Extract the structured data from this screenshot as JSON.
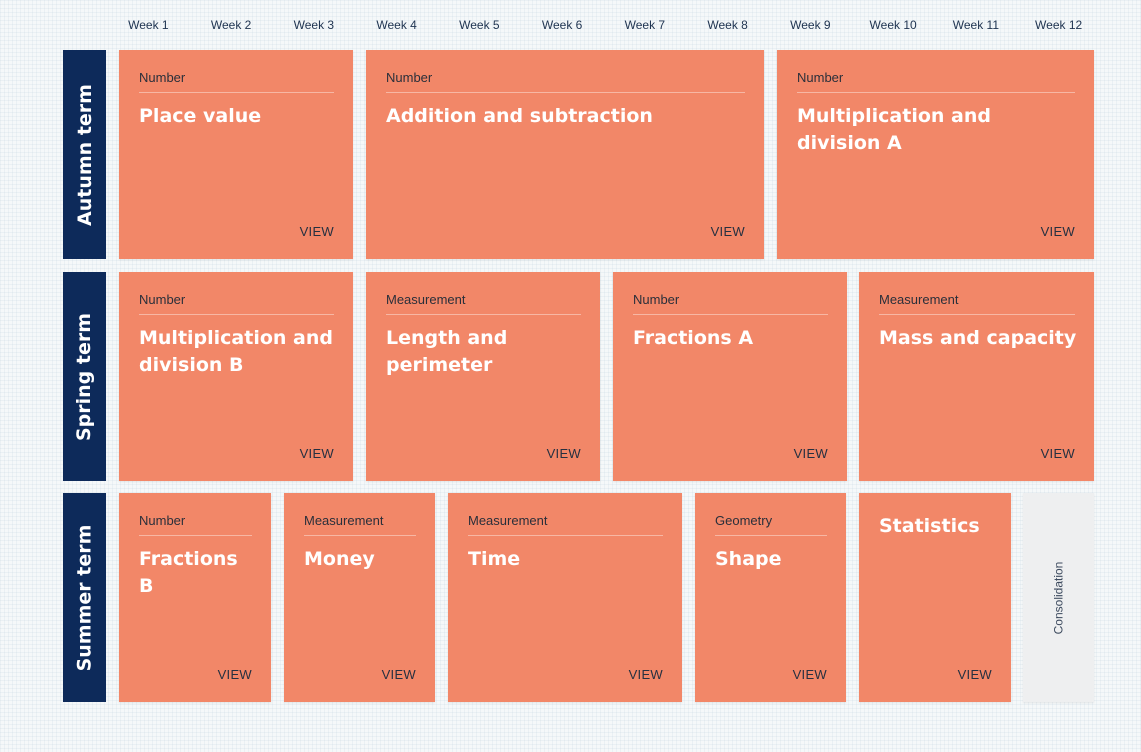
{
  "weeks": [
    "Week 1",
    "Week 2",
    "Week 3",
    "Week 4",
    "Week 5",
    "Week 6",
    "Week 7",
    "Week 8",
    "Week 9",
    "Week 10",
    "Week 11",
    "Week 12"
  ],
  "view_label": "VIEW",
  "colors": {
    "card": "#f28768",
    "term": "#0d2a5a",
    "consolidation": "#eeeff0"
  },
  "terms": [
    {
      "label": "Autumn term",
      "blocks": [
        {
          "category": "Number",
          "title": "Place value"
        },
        {
          "category": "Number",
          "title": "Addition and subtraction"
        },
        {
          "category": "Number",
          "title": "Multiplication and division A"
        }
      ]
    },
    {
      "label": "Spring term",
      "blocks": [
        {
          "category": "Number",
          "title": "Multiplication and division B"
        },
        {
          "category": "Measurement",
          "title": "Length and perimeter"
        },
        {
          "category": "Number",
          "title": "Fractions A"
        },
        {
          "category": "Measurement",
          "title": "Mass and capacity"
        }
      ]
    },
    {
      "label": "Summer term",
      "blocks": [
        {
          "category": "Number",
          "title": "Fractions B"
        },
        {
          "category": "Measurement",
          "title": "Money"
        },
        {
          "category": "Measurement",
          "title": "Time"
        },
        {
          "category": "Geometry",
          "title": "Shape"
        },
        {
          "category": "",
          "title": "Statistics"
        }
      ],
      "consolidation": "Consolidation"
    }
  ]
}
